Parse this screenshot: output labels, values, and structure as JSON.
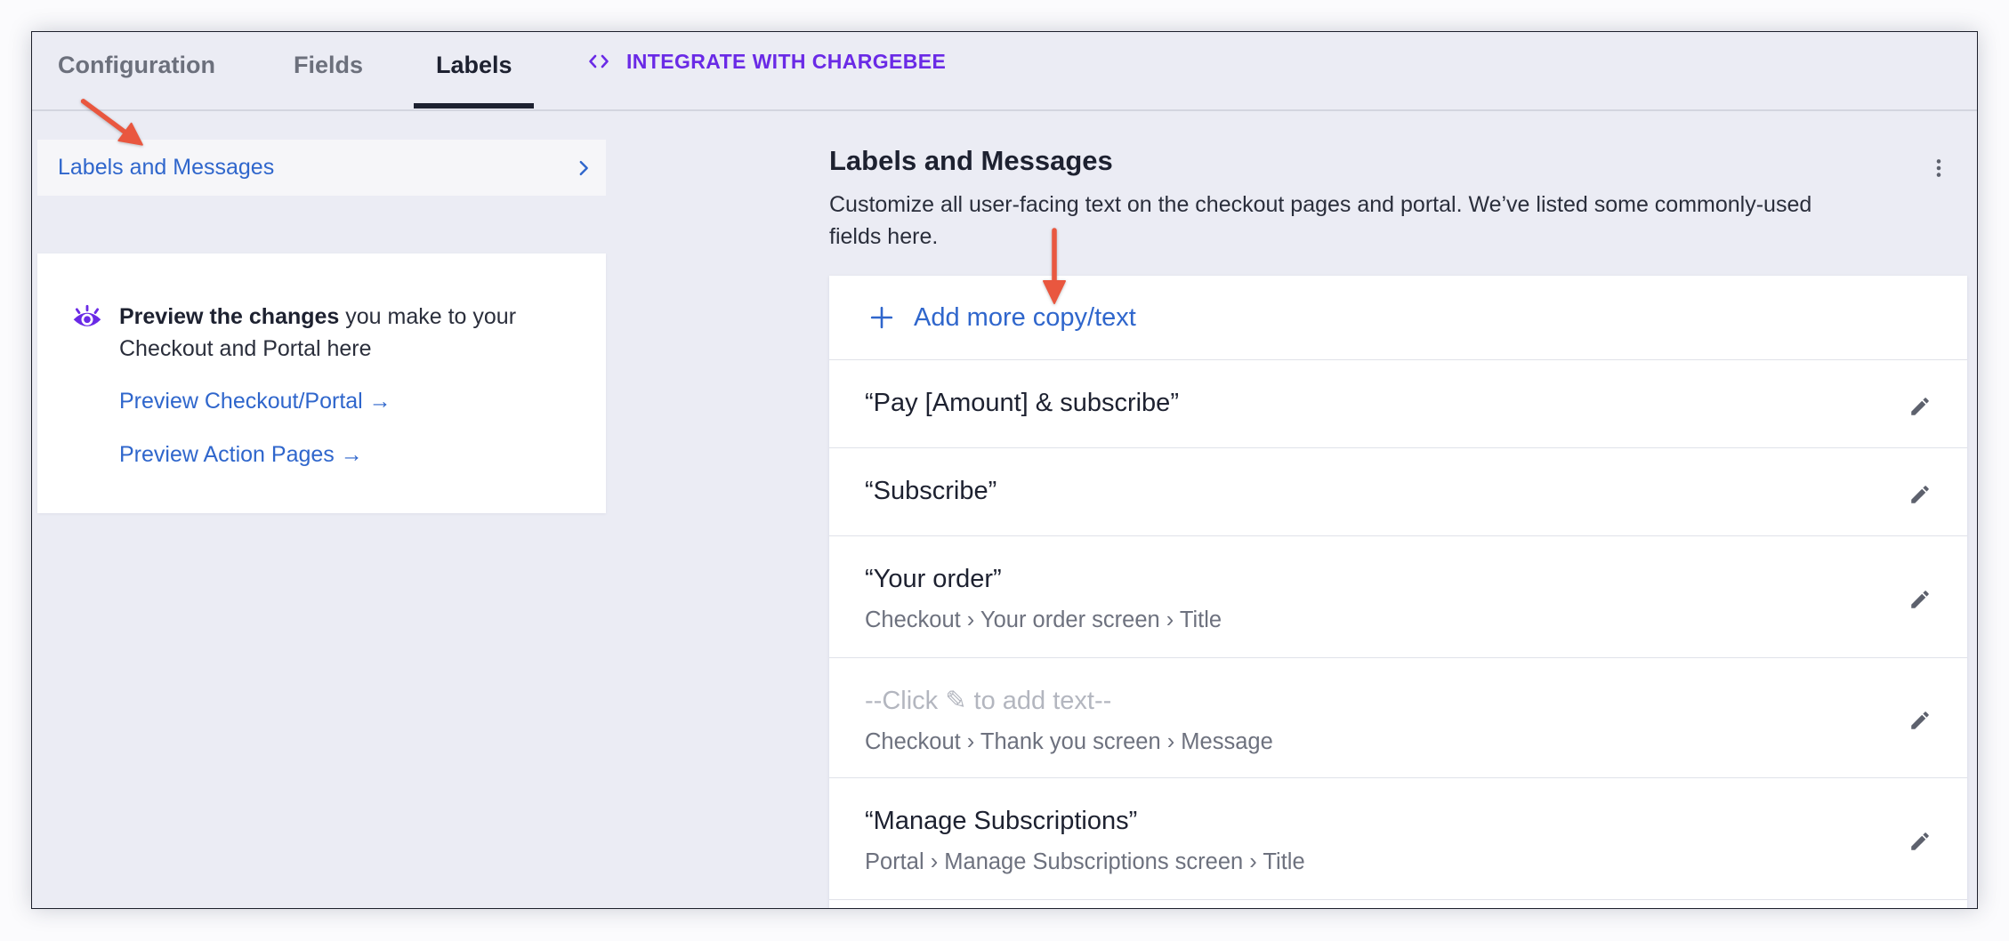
{
  "tabs": [
    {
      "label": "Configuration",
      "active": false
    },
    {
      "label": "Fields",
      "active": false
    },
    {
      "label": "Labels",
      "active": true
    }
  ],
  "integrate": {
    "label": "INTEGRATE WITH CHARGEBEE",
    "icon": "code-brackets-icon"
  },
  "sidebar": {
    "items": [
      {
        "label": "Labels and Messages",
        "icon": "chevron-right-icon",
        "selected": true
      }
    ]
  },
  "preview_card": {
    "icon": "eye-icon",
    "text_bold": "Preview the changes",
    "text_rest": " you make to your Checkout and Portal here",
    "links": [
      {
        "label": "Preview Checkout/Portal →"
      },
      {
        "label": "Preview Action Pages →"
      }
    ]
  },
  "main": {
    "title": "Labels and Messages",
    "description": "Customize all user-facing text on the checkout pages and portal. We’ve listed some commonly-used fields here.",
    "menu_icon": "kebab-menu-icon",
    "add_button": {
      "label": "Add more copy/text",
      "icon": "plus-icon"
    },
    "rows": [
      {
        "text": "“Pay [Amount] & subscribe”",
        "placeholder": false,
        "action_icon": "pencil-icon"
      },
      {
        "text": "“Subscribe”",
        "placeholder": false,
        "action_icon": "pencil-icon"
      },
      {
        "text": "“Your order”",
        "location": "Checkout › Your order screen › Title",
        "placeholder": false,
        "action_icon": "pencil-icon"
      },
      {
        "text": "--Click ✎ to add text--",
        "location": "Checkout › Thank you screen › Message",
        "placeholder": true,
        "action_icon": "pencil-icon"
      },
      {
        "text": "“Manage Subscriptions”",
        "location": "Portal › Manage Subscriptions screen › Title",
        "placeholder": false,
        "action_icon": "pencil-icon"
      }
    ]
  },
  "colors": {
    "accent_purple": "#6a2ae6",
    "link_blue": "#2f66cc",
    "annotation_red": "#e9573f",
    "text_primary": "#1d2130",
    "text_secondary": "#6d717e",
    "background": "#ebecf4"
  }
}
